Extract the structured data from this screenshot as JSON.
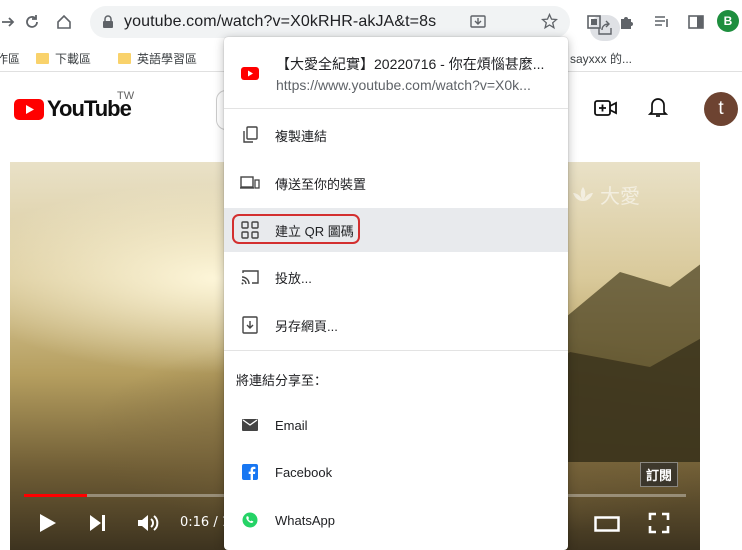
{
  "browser": {
    "url": "youtube.com/watch?v=X0kRHR-akJA&t=8s",
    "profile_initial": "B"
  },
  "bookmarks": [
    {
      "label": "作區"
    },
    {
      "label": "下載區"
    },
    {
      "label": "英語學習區"
    },
    {
      "label": "sayxxx 的..."
    }
  ],
  "youtube": {
    "logo_text": "YouTube",
    "region": "TW",
    "avatar_initial": "t"
  },
  "video": {
    "watermark": "大愛",
    "subscribe_label": "訂閱",
    "time": "0:16 / 1",
    "progress_fraction": 0.095
  },
  "share_menu": {
    "page_title": "【大愛全紀實】20220716 - 你在煩惱甚麼...",
    "page_url": "https://www.youtube.com/watch?v=X0k...",
    "items": [
      {
        "label": "複製連結",
        "icon": "copy-icon"
      },
      {
        "label": "傳送至你的裝置",
        "icon": "devices-icon"
      },
      {
        "label": "建立 QR 圖碼",
        "icon": "qr-code-icon"
      },
      {
        "label": "投放...",
        "icon": "cast-icon"
      },
      {
        "label": "另存網頁...",
        "icon": "save-page-icon"
      }
    ],
    "share_to_label": "將連結分享至：",
    "targets": [
      {
        "label": "Email",
        "icon": "email-icon"
      },
      {
        "label": "Facebook",
        "icon": "facebook-icon"
      },
      {
        "label": "WhatsApp",
        "icon": "whatsapp-icon"
      }
    ]
  },
  "colors": {
    "accent_red": "#d32f2f",
    "youtube_red": "#ff0000",
    "highlight": "#e8eaed"
  }
}
